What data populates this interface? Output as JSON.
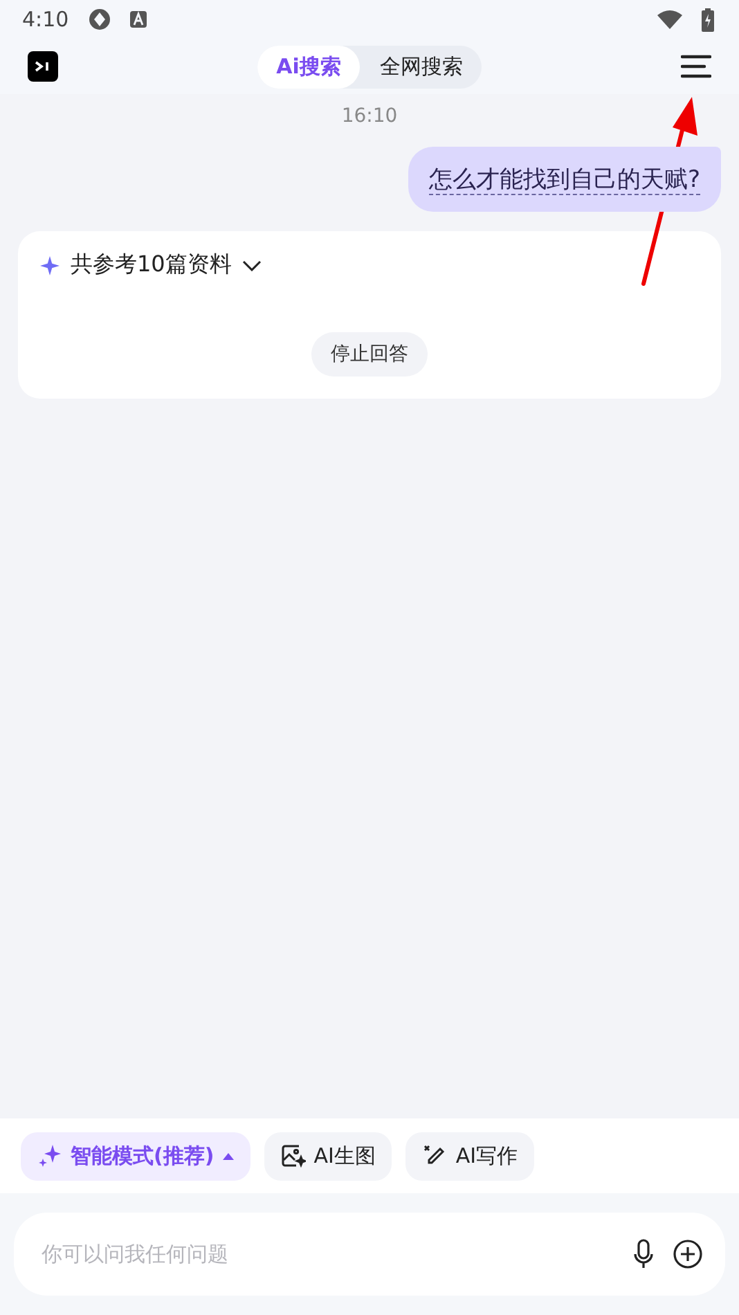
{
  "status_bar": {
    "time": "4:10"
  },
  "header": {
    "tabs": [
      {
        "label": "Ai搜索",
        "selected": true
      },
      {
        "label": "全网搜索",
        "selected": false
      }
    ]
  },
  "chat": {
    "timestamp": "16:10",
    "question": "怎么才能找到自己的天赋?",
    "answer": {
      "sources": "共参考10篇资料",
      "stop_button": "停止回答"
    }
  },
  "tools": [
    {
      "label": "智能模式(推荐)",
      "kind": "mode",
      "selected": true
    },
    {
      "label": "AI生图",
      "kind": "image",
      "selected": false
    },
    {
      "label": "AI写作",
      "kind": "write",
      "selected": false
    }
  ],
  "input": {
    "placeholder": "你可以问我任何问题"
  }
}
